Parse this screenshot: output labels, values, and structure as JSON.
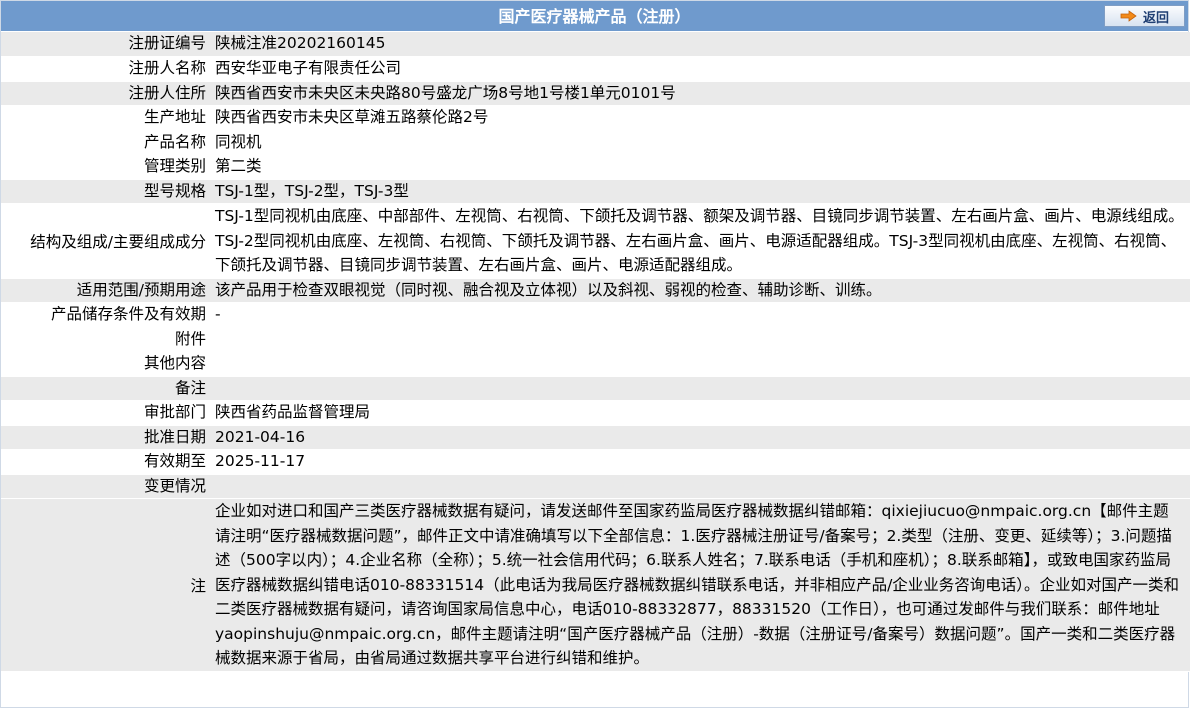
{
  "header": {
    "title": "国产医疗器械产品（注册）",
    "back_label": "返回"
  },
  "rows": [
    {
      "label": "注册证编号",
      "value": "陕械注准20202160145"
    },
    {
      "label": "注册人名称",
      "value": "西安华亚电子有限责任公司"
    },
    {
      "label": "注册人住所",
      "value": "陕西省西安市未央区未央路80号盛龙广场8号地1号楼1单元0101号"
    },
    {
      "label": "生产地址",
      "value": "陕西省西安市未央区草滩五路蔡伦路2号"
    },
    {
      "label": "产品名称",
      "value": "同视机"
    },
    {
      "label": "管理类别",
      "value": "第二类"
    },
    {
      "label": "型号规格",
      "value": "TSJ-1型，TSJ-2型，TSJ-3型"
    },
    {
      "label": "结构及组成/主要组成成分",
      "value": "TSJ-1型同视机由底座、中部部件、左视筒、右视筒、下颌托及调节器、额架及调节器、目镜同步调节装置、左右画片盒、画片、电源线组成。TSJ-2型同视机由底座、左视筒、右视筒、下颌托及调节器、左右画片盒、画片、电源适配器组成。TSJ-3型同视机由底座、左视筒、右视筒、下颌托及调节器、目镜同步调节装置、左右画片盒、画片、电源适配器组成。"
    },
    {
      "label": "适用范围/预期用途",
      "value": "该产品用于检查双眼视觉（同时视、融合视及立体视）以及斜视、弱视的检查、辅助诊断、训练。"
    },
    {
      "label": "产品储存条件及有效期",
      "value": "-"
    },
    {
      "label": "附件",
      "value": ""
    },
    {
      "label": "其他内容",
      "value": ""
    },
    {
      "label": "备注",
      "value": ""
    },
    {
      "label": "审批部门",
      "value": "陕西省药品监督管理局"
    },
    {
      "label": "批准日期",
      "value": "2021-04-16"
    },
    {
      "label": "有效期至",
      "value": "2025-11-17"
    },
    {
      "label": "变更情况",
      "value": ""
    },
    {
      "label": "注",
      "value": "企业如对进口和国产三类医疗器械数据有疑问，请发送邮件至国家药监局医疗器械数据纠错邮箱：qixiejiucuo@nmpaic.org.cn【邮件主题请注明“医疗器械数据问题”，邮件正文中请准确填写以下全部信息：1.医疗器械注册证号/备案号；2.类型（注册、变更、延续等）；3.问题描述（500字以内）；4.企业名称（全称）；5.统一社会信用代码；6.联系人姓名；7.联系电话（手机和座机）；8.联系邮箱】，或致电国家药监局医疗器械数据纠错电话010-88331514（此电话为我局医疗器械数据纠错联系电话，并非相应产品/企业业务咨询电话）。企业如对国产一类和二类医疗器械数据有疑问，请咨询国家局信息中心，电话010-88332877，88331520（工作日），也可通过发邮件与我们联系：邮件地址yaopinshuju@nmpaic.org.cn，邮件主题请注明“国产医疗器械产品（注册）-数据（注册证号/备案号）数据问题”。国产一类和二类医疗器械数据来源于省局，由省局通过数据共享平台进行纠错和维护。"
    }
  ],
  "colors": {
    "header_bg": "#6f9acd",
    "row_alt": "#eaeaea"
  },
  "icons": {
    "back": "arrow-right-icon"
  }
}
